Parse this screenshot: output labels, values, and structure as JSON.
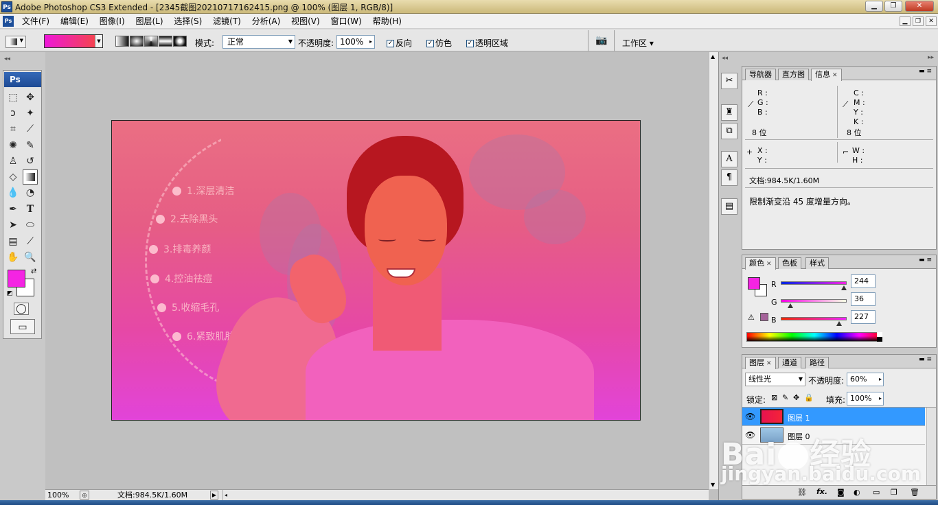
{
  "window": {
    "title": "Adobe Photoshop CS3 Extended - [2345截图20210717162415.png @ 100% (图层 1, RGB/8)]",
    "app_icon": "Ps",
    "min_label": "▁",
    "max_label": "❐",
    "close_label": "✕"
  },
  "menubar": {
    "items": [
      "文件(F)",
      "编辑(E)",
      "图像(I)",
      "图层(L)",
      "选择(S)",
      "滤镜(T)",
      "分析(A)",
      "视图(V)",
      "窗口(W)",
      "帮助(H)"
    ]
  },
  "options": {
    "gradient_colors": [
      "#ee17d9",
      "#f54a3c"
    ],
    "mode_label": "模式:",
    "mode_value": "正常",
    "opacity_label": "不透明度:",
    "opacity_value": "100%",
    "reverse_label": "反向",
    "dither_label": "仿色",
    "transparency_label": "透明区域",
    "workspace_label": "工作区 ▾"
  },
  "toolbox": {
    "logo": "Ps",
    "fg_color": "#f424e3",
    "bg_color": "#ffffff"
  },
  "canvas": {
    "features": [
      "1.深层清洁",
      "2.去除黑头",
      "3.排毒养颜",
      "4.控油祛痘",
      "5.收缩毛孔",
      "6.紧致肌肤"
    ]
  },
  "status": {
    "zoom": "100%",
    "doc_info": "文档:984.5K/1.60M"
  },
  "info_panel": {
    "tabs": [
      "导航器",
      "直方图",
      "信息"
    ],
    "rgb_labels": [
      "R :",
      "G :",
      "B :"
    ],
    "cmyk_labels": [
      "C :",
      "M :",
      "Y :",
      "K :"
    ],
    "bits_left": "8 位",
    "bits_right": "8 位",
    "xy_labels": [
      "X :",
      "Y :"
    ],
    "wh_labels": [
      "W :",
      "H :"
    ],
    "doc": "文档:984.5K/1.60M",
    "hint": "限制渐变沿 45 度增量方向。"
  },
  "color_panel": {
    "tabs": [
      "颜色",
      "色板",
      "样式"
    ],
    "channels": [
      {
        "label": "R",
        "value": "244",
        "level": 0.957
      },
      {
        "label": "G",
        "value": "36",
        "level": 0.141
      },
      {
        "label": "B",
        "value": "227",
        "level": 0.89
      }
    ],
    "current": "#f424e3"
  },
  "layers_panel": {
    "tabs": [
      "图层",
      "通道",
      "路径"
    ],
    "blend_mode": "线性光",
    "opacity_label": "不透明度:",
    "opacity_value": "60%",
    "lock_label": "锁定:",
    "fill_label": "填充:",
    "fill_value": "100%",
    "layers": [
      {
        "name": "图层 1",
        "selected": true
      },
      {
        "name": "图层 0",
        "selected": false
      }
    ]
  },
  "watermark": {
    "brand": "Bai",
    "brand2": "经验",
    "url": "jingyan.baidu.com"
  }
}
